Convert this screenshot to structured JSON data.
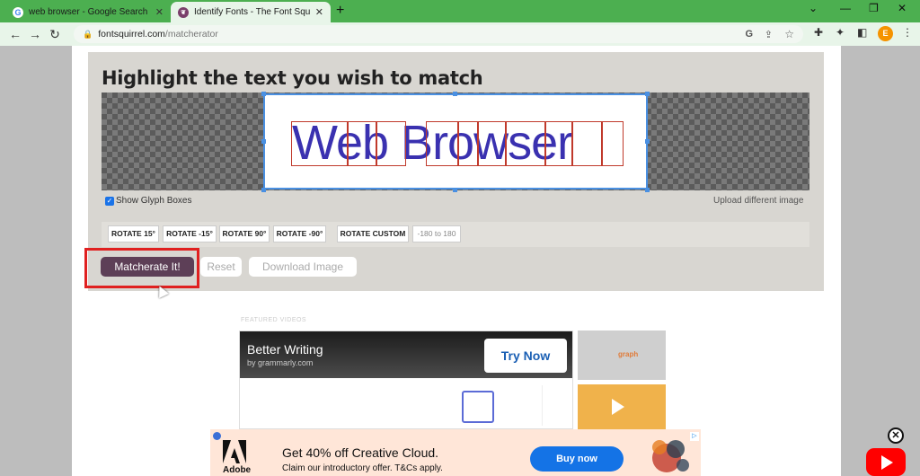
{
  "tabs": [
    {
      "title": "web browser - Google Search",
      "favicon": "G"
    },
    {
      "title": "Identify Fonts - The Font Squirrel",
      "favicon": "FS"
    }
  ],
  "window_controls": {
    "dropdown": "⌄",
    "minimize": "—",
    "restore": "❐",
    "close": "✕"
  },
  "nav": {
    "back": "←",
    "forward": "→",
    "reload": "↻"
  },
  "url": {
    "domain": "fontsquirrel.com",
    "path": "/matcherator"
  },
  "profile_initial": "E",
  "matcher": {
    "heading": "Highlight the text you wish to match",
    "sample_text": "Web Browser",
    "show_glyph_label": "Show Glyph Boxes",
    "upload_label": "Upload different image",
    "rotate_buttons": [
      "ROTATE 15°",
      "ROTATE -15°",
      "ROTATE 90°",
      "ROTATE -90°",
      "ROTATE CUSTOM"
    ],
    "rotate_placeholder": "-180 to 180",
    "matcherate_label": "Matcherate It!",
    "reset_label": "Reset",
    "download_label": "Download Image"
  },
  "featured": {
    "label": "FEATURED VIDEOS",
    "video_title": "Better Writing",
    "video_sub": "by grammarly.com",
    "try_now": "Try Now",
    "thumb_text": "graph"
  },
  "ad": {
    "brand": "Adobe",
    "headline": "Get 40% off Creative Cloud.",
    "subline": "Claim our introductory offer. T&Cs apply.",
    "cta": "Buy now"
  },
  "icons": [
    "google-icon",
    "fontsquirrel-icon",
    "lock-icon",
    "share-icon",
    "star-icon",
    "extension-icon",
    "puzzle-icon",
    "sidebar-icon",
    "kebab-menu-icon",
    "play-icon",
    "close-icon",
    "youtube-icon"
  ]
}
